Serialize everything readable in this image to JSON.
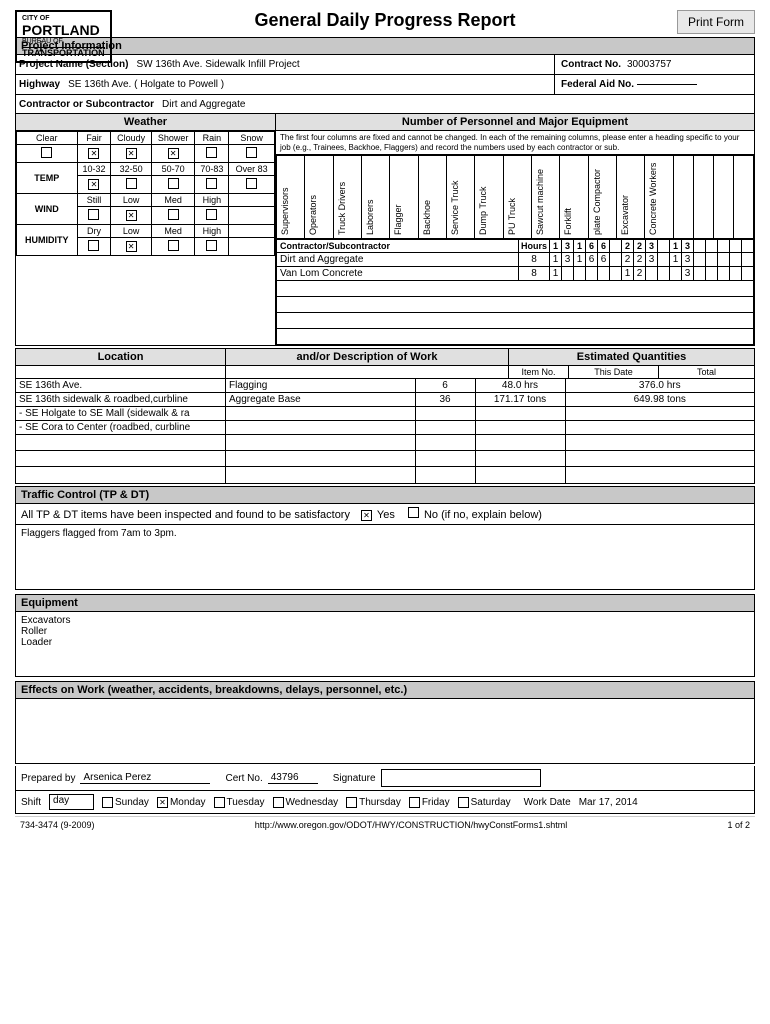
{
  "print_button": "Print Form",
  "page_title": "General Daily Progress Report",
  "logo": {
    "city": "CITY OF",
    "portland": "Portland",
    "bureau": "BUREAU OF",
    "transportation": "Transportation"
  },
  "project_info": {
    "label": "Project Information",
    "name_label": "Project Name (Section)",
    "name_value": "SW 136th Ave. Sidewalk Infill Project",
    "contract_label": "Contract No.",
    "contract_value": "30003757",
    "highway_label": "Highway",
    "highway_value": "SE 136th Ave. ( Holgate to Powell )",
    "federal_label": "Federal Aid No.",
    "federal_value": "",
    "contractor_label": "Contractor or Subcontractor",
    "contractor_value": "Dirt and Aggregate"
  },
  "weather": {
    "header": "Weather",
    "columns": [
      "Clear",
      "Fair",
      "Cloudy",
      "Shower",
      "Rain",
      "Snow"
    ],
    "temp_label": "TEMP",
    "temp_rows": [
      "",
      "10-32",
      "32-50",
      "50-70",
      "70-83",
      "Over 83"
    ],
    "wind_label": "WIND",
    "wind_rows": [
      "Still",
      "Low",
      "Med",
      "High"
    ],
    "humidity_label": "HUMIDITY",
    "humidity_rows": [
      "Dry",
      "Low",
      "Med",
      "High"
    ],
    "checked": {
      "fair": true,
      "cloudy": true,
      "shower": true,
      "temp_1032": true,
      "wind_low": true,
      "humidity_low": true
    }
  },
  "equipment_header": "Number of Personnel and Major Equipment",
  "equipment_note": "The first four columns are fixed and cannot be changed. In each of the remaining columns, please enter a heading specific to your job (e.g., Trainees, Backhoe, Flaggers) and record the numbers used by each contractor or sub.",
  "equipment_columns": [
    "Supervisors",
    "Operators",
    "Truck Drivers",
    "Laborers",
    "Flagger",
    "Backhoe",
    "Service Truck",
    "Dump Truck",
    "PU Truck",
    "Sawcut machine",
    "Forklift",
    "plate Compactor",
    "Excavator",
    "Concrete Workers",
    "",
    "",
    "",
    "",
    ""
  ],
  "contractors": [
    {
      "name": "Contractor/Subcontractor",
      "hours": "Hours",
      "values": [
        "1",
        "3",
        "1",
        "6",
        "6",
        "",
        "2",
        "2",
        "3",
        "",
        "1",
        "3",
        "",
        "",
        "",
        "",
        "",
        "",
        ""
      ]
    },
    {
      "name": "Dirt and Aggregate",
      "hours": "8",
      "values": [
        "1",
        "3",
        "1",
        "6",
        "6",
        "",
        "2",
        "2",
        "3",
        "",
        "1",
        "3",
        "",
        "",
        "",
        "",
        "",
        "",
        ""
      ]
    },
    {
      "name": "Van Lom Concrete",
      "hours": "8",
      "values": [
        "1",
        "",
        "",
        "",
        "",
        "",
        "1",
        "2",
        "",
        "",
        "",
        "3",
        "",
        "",
        "",
        "",
        "",
        "",
        ""
      ]
    },
    {
      "name": "",
      "hours": "",
      "values": [
        "",
        "",
        "",
        "",
        "",
        "",
        "",
        "",
        "",
        "",
        "",
        "",
        "",
        "",
        "",
        "",
        "",
        "",
        ""
      ]
    },
    {
      "name": "",
      "hours": "",
      "values": [
        "",
        "",
        "",
        "",
        "",
        "",
        "",
        "",
        "",
        "",
        "",
        "",
        "",
        "",
        "",
        "",
        "",
        "",
        ""
      ]
    },
    {
      "name": "",
      "hours": "",
      "values": [
        "",
        "",
        "",
        "",
        "",
        "",
        "",
        "",
        "",
        "",
        "",
        "",
        "",
        "",
        "",
        "",
        "",
        "",
        ""
      ]
    }
  ],
  "location": {
    "header": "Location",
    "desc_header": "and/or Description of Work",
    "qty_header": "Estimated Quantities",
    "item_no_label": "Item No.",
    "this_date_label": "This Date",
    "total_label": "Total",
    "rows": [
      {
        "location": "SE 136th Ave.",
        "description": "Flagging",
        "item_no": "6",
        "this_date": "48.0 hrs",
        "total": "376.0 hrs"
      },
      {
        "location": "SE 136th sidewalk & roadbed,curbline",
        "description": "Aggregate Base",
        "item_no": "36",
        "this_date": "171.17 tons",
        "total": "649.98 tons"
      },
      {
        "location": "- SE Holgate to SE  Mall (sidewalk & ra",
        "description": "",
        "item_no": "",
        "this_date": "",
        "total": ""
      },
      {
        "location": "- SE Cora to Center (roadbed, curbline",
        "description": "",
        "item_no": "",
        "this_date": "",
        "total": ""
      },
      {
        "location": "",
        "description": "",
        "item_no": "",
        "this_date": "",
        "total": ""
      },
      {
        "location": "",
        "description": "",
        "item_no": "",
        "this_date": "",
        "total": ""
      },
      {
        "location": "",
        "description": "",
        "item_no": "",
        "this_date": "",
        "total": ""
      }
    ]
  },
  "traffic": {
    "header": "Traffic Control (TP & DT)",
    "inspection_text": "All TP & DT items have been inspected and found to be satisfactory",
    "yes_label": "Yes",
    "no_label": "No (if no, explain below)",
    "yes_checked": true,
    "no_checked": false,
    "notes": "Flaggers flagged from 7am to 3pm."
  },
  "equipment_section": {
    "header": "Equipment",
    "items": "Excavators\nRoller\nLoader"
  },
  "effects": {
    "header": "Effects on Work (weather, accidents, breakdowns, delays, personnel, etc.)",
    "content": ""
  },
  "footer": {
    "prepared_by_label": "Prepared by",
    "prepared_by_value": "Arsenica Perez",
    "cert_label": "Cert No.",
    "cert_value": "43796",
    "signature_label": "Signature",
    "shift_label": "Shift",
    "shift_value": "day",
    "days": [
      "Sunday",
      "Monday",
      "Tuesday",
      "Wednesday",
      "Thursday",
      "Friday",
      "Saturday"
    ],
    "monday_checked": true,
    "thursday_label": "Thursday",
    "work_date_label": "Work Date",
    "work_date_value": "Mar 17, 2014"
  },
  "bottom": {
    "form_number": "734-3474 (9-2009)",
    "url": "http://www.oregon.gov/ODOT/HWY/CONSTRUCTION/hwyConstForms1.shtml",
    "page": "1 of 2"
  }
}
